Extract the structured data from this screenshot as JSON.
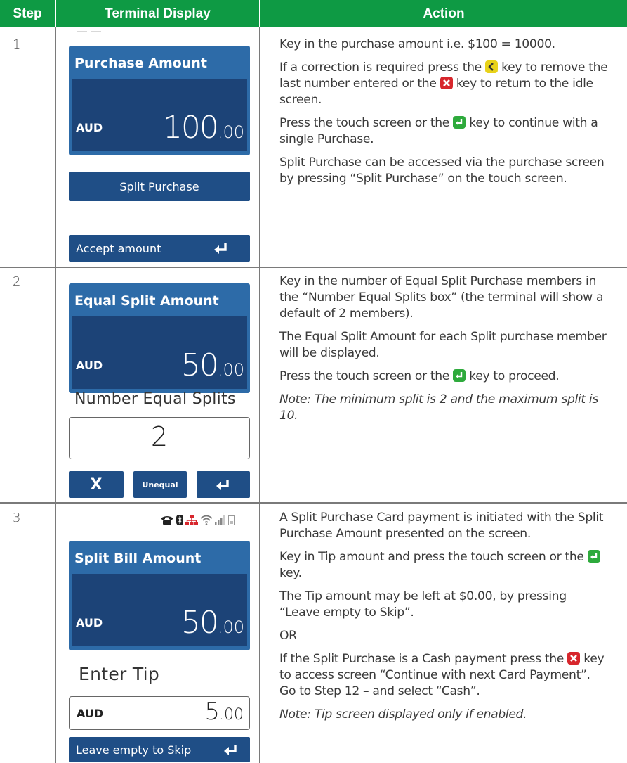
{
  "header": {
    "step": "Step",
    "display": "Terminal Display",
    "action": "Action"
  },
  "colors": {
    "header_green": "#0e9a44",
    "panel_blue": "#2d6ba8",
    "panel_navy": "#1c4377",
    "button_navy": "#1f4e86",
    "key_yellow": "#e8d21a",
    "key_red": "#d7262c",
    "key_green": "#2eaa3c"
  },
  "rows": [
    {
      "step": "1",
      "display": {
        "title": "Purchase Amount",
        "currency": "AUD",
        "amount_int": "100",
        "amount_dec": ".00",
        "split_button": "Split Purchase",
        "accept_button": "Accept amount"
      },
      "action": {
        "p1": "Key in the purchase amount i.e. $100 = 10000.",
        "p2a": "If a correction is required press the ",
        "p2b": " key to remove the last number entered or the ",
        "p2c": " key to return to the idle screen.",
        "p3a": "Press the touch screen or the ",
        "p3b": " key to continue with a single Purchase.",
        "p4": "Split Purchase can be accessed via the purchase screen by pressing “Split Purchase” on the touch screen."
      }
    },
    {
      "step": "2",
      "display": {
        "title": "Equal Split Amount",
        "currency": "AUD",
        "amount_int": "50",
        "amount_dec": ".00",
        "splits_label": "Number Equal Splits",
        "splits_value": "2",
        "cancel_glyph": "X",
        "unequal_button": "Unequal"
      },
      "action": {
        "p1": "Key in the number of Equal Split Purchase members in the “Number Equal Splits box” (the terminal will show a default of 2 members).",
        "p2": "The Equal Split Amount for each Split purchase member will be displayed.",
        "p3a": "Press the touch screen or the ",
        "p3b": " key to proceed.",
        "note": "Note: The minimum split is 2 and the maximum split is 10."
      }
    },
    {
      "step": "3",
      "display": {
        "title": "Split Bill Amount",
        "currency": "AUD",
        "amount_int": "50",
        "amount_dec": ".00",
        "tip_label": "Enter Tip",
        "tip_currency": "AUD",
        "tip_int": "5",
        "tip_dec": ".00",
        "skip_button": "Leave empty to Skip",
        "status_icons": [
          "phone-icon",
          "bluetooth-icon",
          "network-icon",
          "wifi-icon",
          "signal-icon",
          "battery-icon"
        ]
      },
      "action": {
        "p1": "A Split Purchase Card payment is initiated with the Split Purchase Amount presented on the screen.",
        "p2a": "Key in Tip amount and press the touch screen or the ",
        "p2b": " key.",
        "p3": "The Tip amount may be left at $0.00, by pressing “Leave empty to Skip”.",
        "or": "OR",
        "p4a": "If the Split Purchase is a Cash payment press the ",
        "p4b": " key to access screen “Continue with next Card Payment”. Go to Step 12 – and select “Cash”.",
        "note": "Note: Tip screen displayed only if enabled."
      }
    }
  ]
}
